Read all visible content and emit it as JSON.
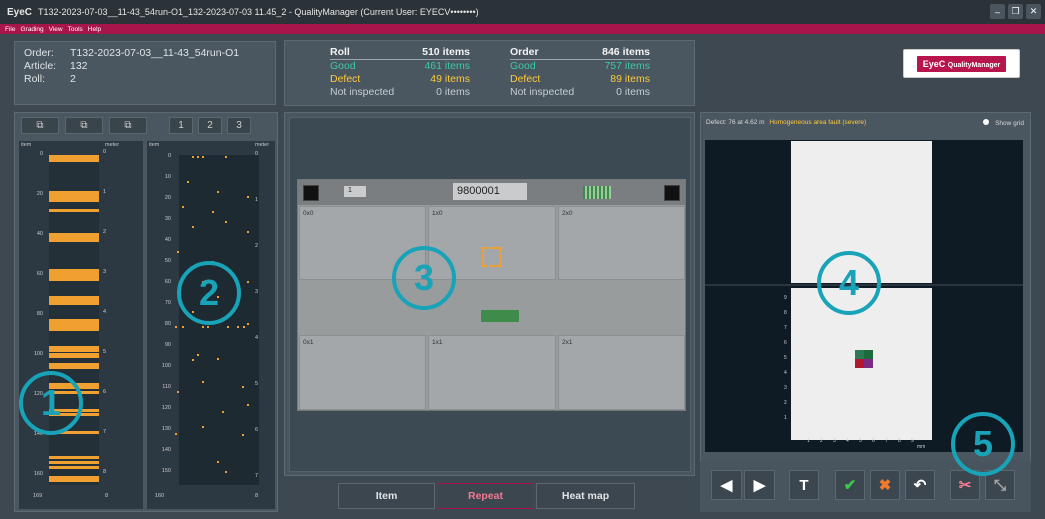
{
  "window": {
    "logo": "EyeC",
    "title": "T132-2023-07-03__11-43_54run-O1_132-2023-07-03 11.45_2  -  QualityManager   (Current User: EYECV••••••••)"
  },
  "menu": [
    "File",
    "Grading",
    "View",
    "Tools",
    "Help"
  ],
  "info": {
    "order_label": "Order:",
    "order": "T132-2023-07-03__11-43_54run-O1",
    "article_label": "Article:",
    "article": "132",
    "roll_label": "Roll:",
    "roll": "2"
  },
  "stats": {
    "roll": {
      "title": "Roll",
      "total": "510",
      "good": "461",
      "defect": "49",
      "not_inspected": "0"
    },
    "order": {
      "title": "Order",
      "total": "846",
      "good": "757",
      "defect": "89",
      "not_inspected": "0"
    },
    "labels": {
      "items": "items",
      "good": "Good",
      "defect": "Defect",
      "ni": "Not inspected"
    }
  },
  "brand": {
    "eyec": "EyeC",
    "product": "QualityManager"
  },
  "left": {
    "pages": [
      "1",
      "2",
      "3"
    ],
    "strip1_ticks": [
      "0",
      "20",
      "40",
      "60",
      "80",
      "100",
      "120",
      "140",
      "160"
    ],
    "strip2_ticks": [
      "0",
      "10",
      "20",
      "30",
      "40",
      "50",
      "60",
      "70",
      "80",
      "90",
      "100",
      "110",
      "120",
      "130",
      "140",
      "150"
    ],
    "meter_ticks1": [
      "0",
      "1",
      "2",
      "3",
      "4",
      "5",
      "6",
      "7",
      "8"
    ],
    "meter_ticks2": [
      "0",
      "1",
      "2",
      "3",
      "4",
      "5",
      "6",
      "7"
    ],
    "item": "item",
    "meter": "meter",
    "bottom1": "169",
    "bottom1m": "8",
    "bottom2": "160",
    "bottom2m": "8"
  },
  "repeat": {
    "page": "1",
    "code": "9800001",
    "cells": [
      "0x0",
      "1x0",
      "2x0",
      "0x1",
      "1x1",
      "2x1"
    ]
  },
  "tabs": {
    "item": "Item",
    "repeat": "Repeat",
    "heatmap": "Heat map"
  },
  "defect": {
    "info": "Defect: 76 at 4.62 m",
    "type": "Homogeneous area fault (severe)",
    "show_grid": "Show grid",
    "yticks": [
      "9",
      "8",
      "7",
      "6",
      "5",
      "4",
      "3",
      "2",
      "1"
    ],
    "xticks": [
      "1",
      "2",
      "3",
      "4",
      "5",
      "6",
      "7",
      "8",
      "9"
    ],
    "unit": "mm"
  },
  "callouts": [
    "1",
    "2",
    "3",
    "4",
    "5"
  ],
  "colors": {
    "accent": "#a8154a",
    "good": "#3cc9a6",
    "defect": "#ffc93a",
    "callout": "#18a3b8"
  }
}
